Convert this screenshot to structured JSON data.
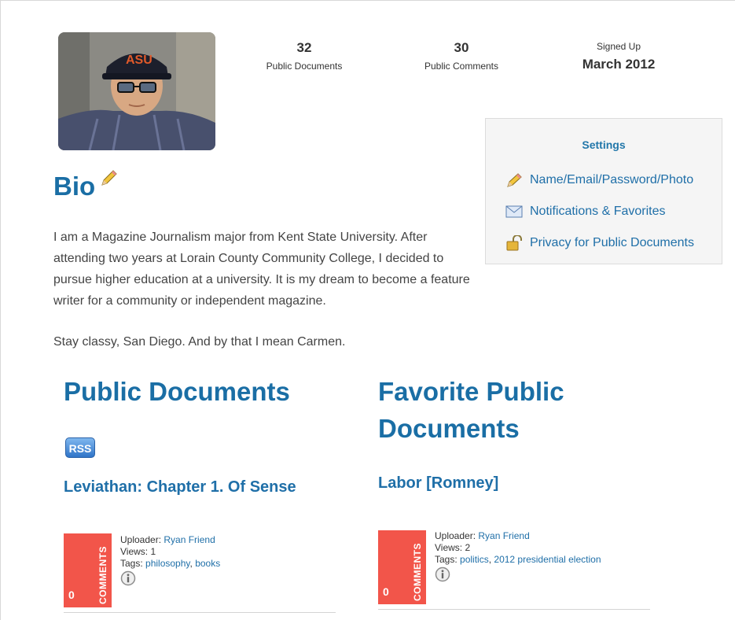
{
  "stats": {
    "documents": {
      "value": "32",
      "label": "Public Documents"
    },
    "comments": {
      "value": "30",
      "label": "Public Comments"
    },
    "signup": {
      "label": "Signed Up",
      "value": "March 2012"
    }
  },
  "settings": {
    "title": "Settings",
    "items": [
      {
        "label": "Name/Email/Password/Photo",
        "icon": "pencil-icon"
      },
      {
        "label": "Notifications & Favorites",
        "icon": "envelope-icon"
      },
      {
        "label": "Privacy for Public Documents",
        "icon": "padlock-icon"
      }
    ]
  },
  "bio": {
    "heading": "Bio",
    "paragraph1": "I am a Magazine Journalism major from Kent State University. After attending two years at Lorain County Community College, I decided to pursue higher education at a university. It is my dream to become a feature writer for a community or independent magazine.",
    "paragraph2": "Stay classy, San Diego. And by that I mean Carmen."
  },
  "public_documents": {
    "heading": "Public Documents",
    "rss_label": "RSS",
    "doc": {
      "title": "Leviathan: Chapter 1. Of Sense",
      "comment_count": "0",
      "comments_label": "COMMENTS",
      "uploader_label": "Uploader:",
      "uploader": "Ryan Friend",
      "views": "Views: 1",
      "tags_label": "Tags:",
      "tags": [
        "philosophy",
        "books"
      ]
    }
  },
  "favorite_documents": {
    "heading_line1": "Favorite Public",
    "heading_line2": "Documents",
    "doc": {
      "title": "Labor [Romney]",
      "comment_count": "0",
      "comments_label": "COMMENTS",
      "uploader_label": "Uploader:",
      "uploader": "Ryan Friend",
      "views": "Views: 2",
      "tags_label": "Tags:",
      "tags": [
        "politics",
        "2012 presidential election"
      ]
    }
  },
  "colors": {
    "accent": "#1a6ea5",
    "comments_box": "#f2554a"
  }
}
